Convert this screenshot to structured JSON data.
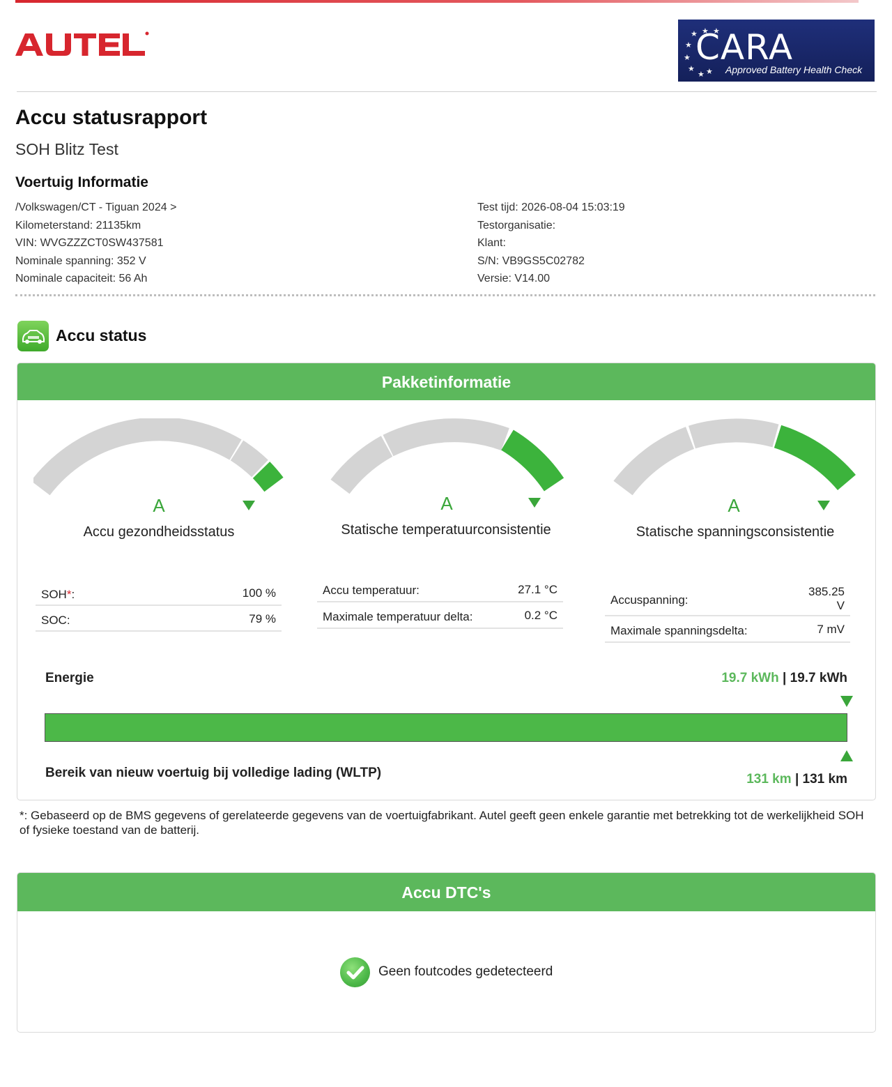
{
  "brand": {
    "logo_text": "AUTEL",
    "registered": "®",
    "color": "#d7262e"
  },
  "cara_badge": {
    "word": "CARA",
    "subtitle": "Approved Battery Health Check",
    "bg": "#1f2f7a"
  },
  "report": {
    "title": "Accu statusrapport",
    "subtitle": "SOH Blitz Test"
  },
  "vehicle_info": {
    "heading": "Voertuig Informatie",
    "left": [
      "/Volkswagen/CT - Tiguan 2024 >",
      "Kilometerstand: 21135km",
      "VIN: WVGZZZCT0SW437581",
      "Nominale spanning: 352 V",
      "Nominale capaciteit: 56 Ah"
    ],
    "right": [
      "Test tijd: 2026-08-04 15:03:19",
      "Testorganisatie:",
      "Klant:",
      "S/N: VB9GS5C02782",
      "Versie: V14.00"
    ]
  },
  "battery_status": {
    "heading": "Accu status",
    "icon": "car-battery-icon",
    "panel_title": "Pakketinformatie",
    "accent": "#5cb85c",
    "gauges": [
      {
        "grade": "A",
        "label": "Accu gezondheidsstatus",
        "level": 1.0
      },
      {
        "grade": "A",
        "label": "Statische temperatuurconsistentie",
        "level": 1.0
      },
      {
        "grade": "A",
        "label": "Statische spanningsconsistentie",
        "level": 1.0
      }
    ],
    "soh_table": {
      "soh_key": "SOH",
      "soh_mark": "*",
      "soh_colon": ":",
      "soh_value": "100 %",
      "soc_key": "SOC:",
      "soc_value": "79 %"
    },
    "temp_table": {
      "temp_key": "Accu temperatuur:",
      "temp_value": "27.1 °C",
      "delta_key": "Maximale temperatuur delta:",
      "delta_value": "0.2 °C"
    },
    "volt_table": {
      "volt_key": "Accuspanning:",
      "volt_value_num": "385.25",
      "volt_value_unit": "V",
      "delta_key": "Maximale spanningsdelta:",
      "delta_value": "7 mV"
    },
    "energy": {
      "label": "Energie",
      "current": "19.7 kWh",
      "separator": "|",
      "nominal": "19.7 kWh",
      "fill_fraction": 1.0
    },
    "range": {
      "label": "Bereik van nieuw voertuig bij volledige lading (WLTP)",
      "current": "131 km",
      "separator": "|",
      "nominal": "131 km"
    }
  },
  "footnote": "*: Gebaseerd op de BMS gegevens of gerelateerde gegevens van de voertuigfabrikant. Autel geeft geen enkele garantie met betrekking tot de werkelijkheid SOH of fysieke toestand van de batterij.",
  "dtc": {
    "panel_title": "Accu DTC's",
    "message": "Geen foutcodes gedetecteerd",
    "icon": "check-circle-icon"
  }
}
